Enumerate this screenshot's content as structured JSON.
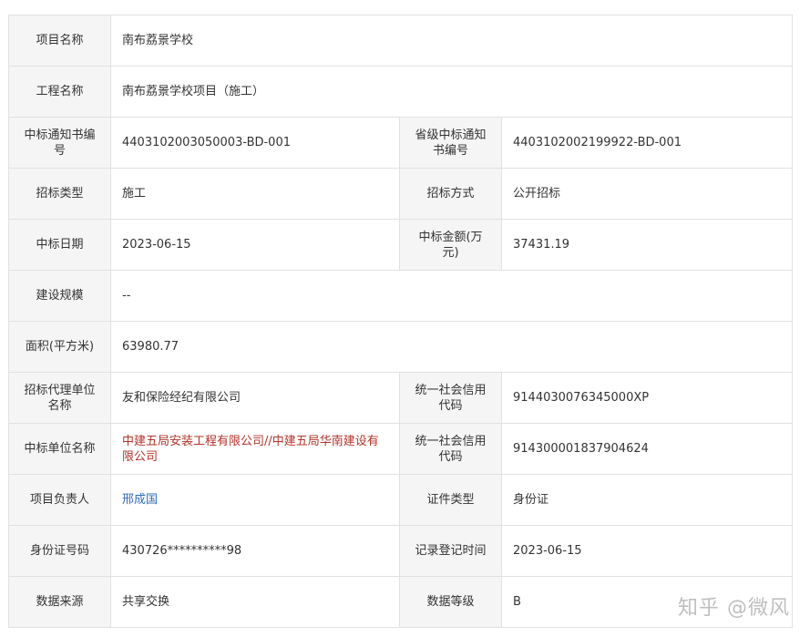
{
  "rows": {
    "project_name": {
      "label": "项目名称",
      "value": "南布荔景学校"
    },
    "engineering_name": {
      "label": "工程名称",
      "value": "南布荔景学校项目（施工）"
    },
    "notice_no": {
      "label": "中标通知书编号",
      "value": "4403102003050003-BD-001",
      "label2": "省级中标通知书编号",
      "value2": "4403102002199922-BD-001"
    },
    "bid_type": {
      "label": "招标类型",
      "value": "施工",
      "label2": "招标方式",
      "value2": "公开招标"
    },
    "bid_date": {
      "label": "中标日期",
      "value": "2023-06-15",
      "label2": "中标金额(万元)",
      "value2": "37431.19"
    },
    "scale": {
      "label": "建设规模",
      "value": "--"
    },
    "area": {
      "label": "面积(平方米)",
      "value": "63980.77"
    },
    "agent": {
      "label": "招标代理单位名称",
      "value": "友和保险经纪有限公司",
      "label2": "统一社会信用代码",
      "value2": "9144030076345000XP"
    },
    "winner": {
      "label": "中标单位名称",
      "value": "中建五局安装工程有限公司//中建五局华南建设有限公司",
      "label2": "统一社会信用代码",
      "value2": "914300001837904624"
    },
    "manager": {
      "label": "项目负责人",
      "value": "邢成国",
      "label2": "证件类型",
      "value2": "身份证"
    },
    "id_no": {
      "label": "身份证号码",
      "value": "430726**********98",
      "label2": "记录登记时间",
      "value2": "2023-06-15"
    },
    "source": {
      "label": "数据来源",
      "value": "共享交换",
      "label2": "数据等级",
      "value2": "B"
    }
  },
  "watermark": "知乎 @微风",
  "colors": {
    "label_bg": "#f5f5f5",
    "border": "#e1e1e1",
    "winner_text": "#b0342a",
    "manager_link": "#2f6db5"
  }
}
